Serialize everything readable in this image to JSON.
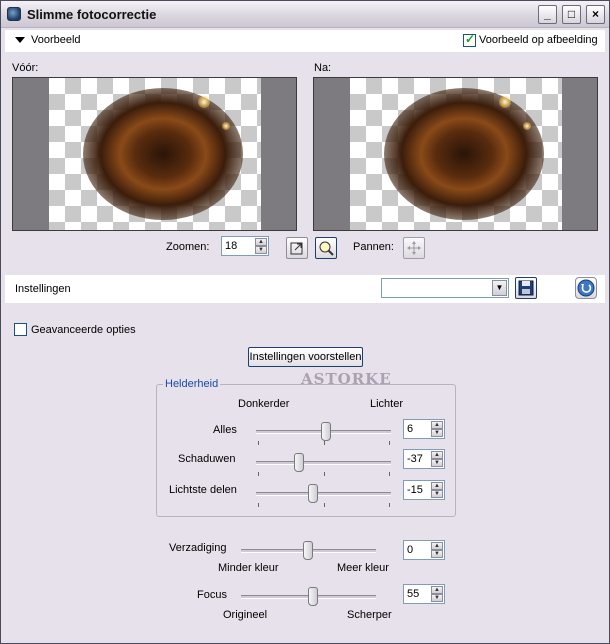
{
  "window": {
    "title": "Slimme fotocorrectie"
  },
  "preview_section": {
    "label": "Voorbeeld",
    "preview_on_image_label": "Voorbeeld op afbeelding",
    "preview_on_image_checked": true,
    "before_label": "Vóór:",
    "after_label": "Na:",
    "zoom_label": "Zoomen:",
    "zoom_value": "18",
    "pan_label": "Pannen:"
  },
  "settings_section": {
    "label": "Instellingen",
    "preset_value": ""
  },
  "advanced_options": {
    "label": "Geavanceerde opties",
    "checked": false
  },
  "suggest_button_label": "Instellingen voorstellen",
  "watermark": "ASTORKE",
  "brightness": {
    "title": "Helderheid",
    "left_label": "Donkerder",
    "right_label": "Lichter",
    "sliders": [
      {
        "label": "Alles",
        "value": "6"
      },
      {
        "label": "Schaduwen",
        "value": "-37"
      },
      {
        "label": "Lichtste delen",
        "value": "-15"
      }
    ]
  },
  "saturation": {
    "label": "Verzadiging",
    "value": "0",
    "left_label": "Minder kleur",
    "right_label": "Meer kleur"
  },
  "focus": {
    "label": "Focus",
    "value": "55",
    "left_label": "Origineel",
    "right_label": "Scherper"
  },
  "title_buttons": {
    "minimize": "_",
    "maximize": "□",
    "close": "×"
  }
}
